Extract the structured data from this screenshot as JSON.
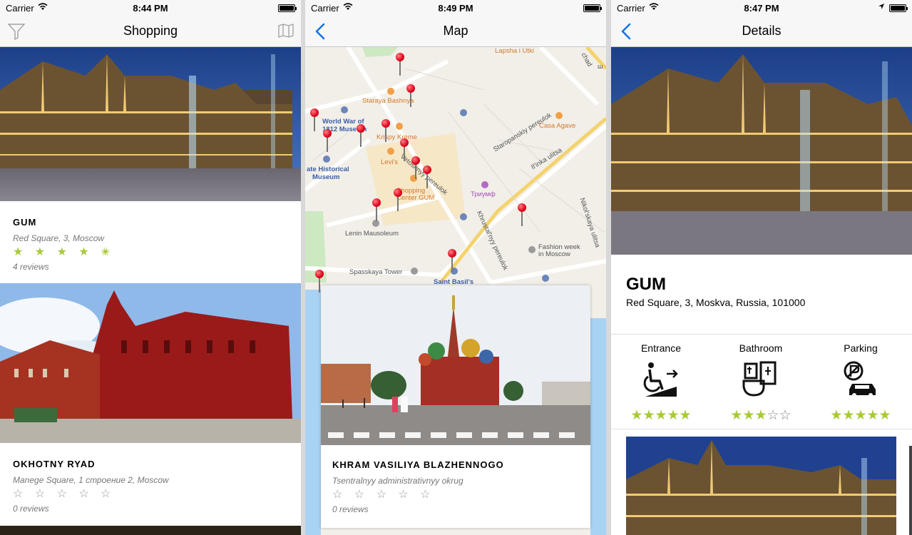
{
  "screens": [
    {
      "status": {
        "carrier": "Carrier",
        "time": "8:44 PM"
      },
      "nav": {
        "title": "Shopping",
        "left_icon": "filter-icon",
        "right_icon": "map-icon"
      },
      "items": [
        {
          "name": "GUM",
          "address": "Red Square, 3, Moscow",
          "rating": 4.5,
          "stars": "★ ★ ★ ★ ",
          "half": "✬",
          "reviews": "4 reviews"
        },
        {
          "name": "OKHOTNY RYAD",
          "address": "Manege Square, 1 строение 2, Moscow",
          "rating": 0,
          "stars": "☆ ☆ ☆ ☆ ☆",
          "reviews": "0 reviews"
        }
      ]
    },
    {
      "status": {
        "carrier": "Carrier",
        "time": "8:49 PM"
      },
      "nav": {
        "title": "Map",
        "left_icon": "back-chevron-icon"
      },
      "map_labels": {
        "lapsha": "Lapsha i Utki",
        "staraya": "Staraya Bashnya",
        "ww2": "World War of",
        "ww2b": "1812 Museum",
        "krispy": "Krispy Kreme",
        "levis": "Levi's",
        "state_hist": "ate Historical",
        "state_hist2": "Museum",
        "staropansky": "Staropanskiy pereulok",
        "casa": "Casa Agave",
        "ilinka": "Il'inka ulitsa",
        "vetoshny": "Vetoshnyy pereulok",
        "shopping": "Shopping",
        "center_gum": "Center GUM",
        "triumf": "Триумф",
        "khrustalny": "Khrustal'nyy pereulok",
        "nikolskaya": "Nikol'skaya ulitsa",
        "lenin": "Lenin Mausoleum",
        "fashion": "Fashion week",
        "fashion2": "in Moscow",
        "spasskaya": "Spasskaya Tower",
        "saint_basil": "Saint Basil's",
        "sh": "ш",
        "chad": "chad"
      },
      "card": {
        "name": "KHRAM VASILIYA BLAZHENNOGO",
        "address": "Tsentralnyy administrativnyy okrug",
        "stars": "☆ ☆ ☆ ☆ ☆",
        "rating": 0,
        "reviews": "0 reviews"
      }
    },
    {
      "status": {
        "carrier": "Carrier",
        "time": "8:47 PM"
      },
      "nav": {
        "title": "Details",
        "left_icon": "back-chevron-icon"
      },
      "place": {
        "name": "GUM",
        "address": "Red Square, 3, Moskva, Russia, 101000"
      },
      "amenities": [
        {
          "label": "Entrance",
          "icon": "wheelchair-ramp-icon",
          "rating": 5,
          "stars_on": "★★★★★",
          "stars_off": ""
        },
        {
          "label": "Bathroom",
          "icon": "accessible-bathroom-icon",
          "rating": 3,
          "stars_on": "★★★",
          "stars_off": "☆☆"
        },
        {
          "label": "Parking",
          "icon": "accessible-parking-icon",
          "rating": 5,
          "stars_on": "★★★★★",
          "stars_off": ""
        }
      ]
    }
  ],
  "colors": {
    "star_on": "#a8c93a",
    "ios_blue": "#1a73e8",
    "pin_red": "#e0001b"
  }
}
